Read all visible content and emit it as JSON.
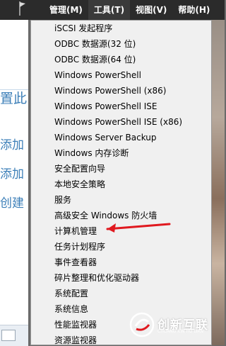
{
  "menubar": {
    "items": [
      {
        "label": "管理(M)"
      },
      {
        "label": "工具(T)"
      },
      {
        "label": "视图(V)"
      },
      {
        "label": "帮助(H)"
      }
    ],
    "active_index": 1
  },
  "left_panel": {
    "texts": [
      "置此",
      "添加",
      "添加",
      "创建"
    ],
    "text_color": "#3c7fb8"
  },
  "tools_menu": {
    "items": [
      "iSCSI 发起程序",
      "ODBC 数据源(32 位)",
      "ODBC 数据源(64 位)",
      "Windows PowerShell",
      "Windows PowerShell (x86)",
      "Windows PowerShell ISE",
      "Windows PowerShell ISE (x86)",
      "Windows Server Backup",
      "Windows 内存诊断",
      "安全配置向导",
      "本地安全策略",
      "服务",
      "高级安全 Windows 防火墙",
      "计算机管理",
      "任务计划程序",
      "事件查看器",
      "碎片整理和优化驱动器",
      "系统配置",
      "系统信息",
      "性能监视器",
      "资源监视器"
    ],
    "highlighted_item": "计算机管理",
    "annotation_arrow_color": "#e0191f"
  },
  "watermark": {
    "text": "创新互联",
    "subtext": "CHUANG XIN HU LIAN"
  }
}
